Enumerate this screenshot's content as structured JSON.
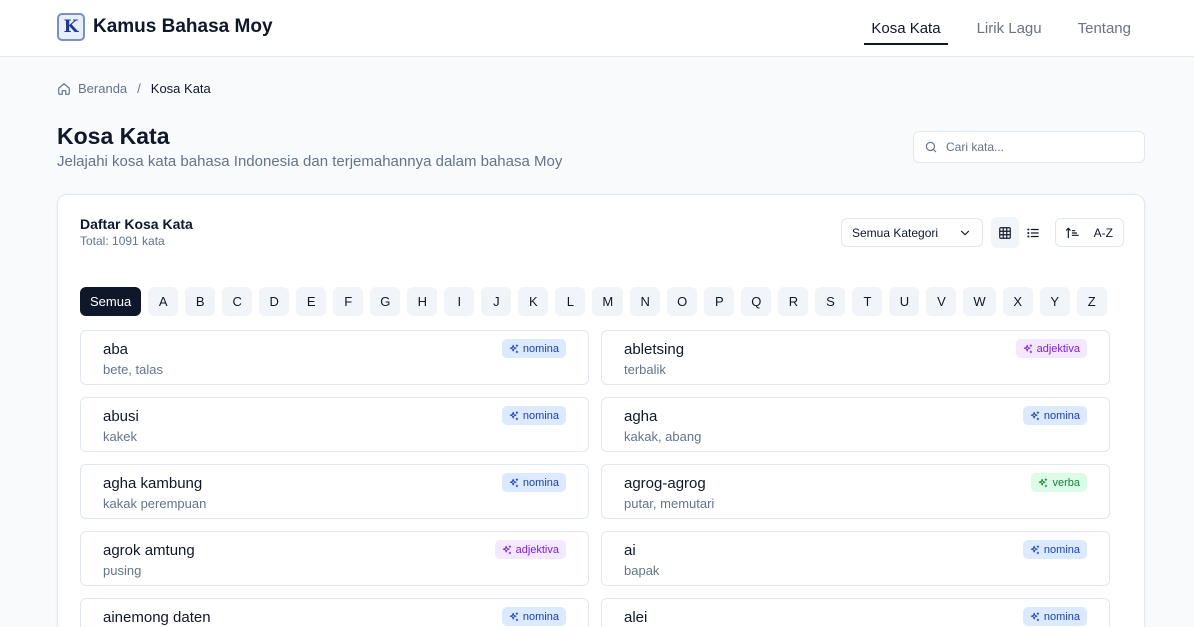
{
  "app": {
    "brand_logo_letter": "K",
    "brand_name": "Kamus Bahasa Moy"
  },
  "nav": {
    "items": [
      {
        "label": "Kosa Kata",
        "active": true
      },
      {
        "label": "Lirik Lagu",
        "active": false
      },
      {
        "label": "Tentang",
        "active": false
      }
    ]
  },
  "breadcrumb": {
    "home": "Beranda",
    "separator": "/",
    "current": "Kosa Kata"
  },
  "page": {
    "title": "Kosa Kata",
    "subtitle": "Jelajahi kosa kata bahasa Indonesia dan terjemahannya dalam bahasa Moy"
  },
  "search": {
    "placeholder": "Cari kata...",
    "value": ""
  },
  "card": {
    "title": "Daftar Kosa Kata",
    "count": "Total: 1091 kata",
    "category_select": "Semua Kategori",
    "sort_label": "A-Z",
    "view_mode": "grid"
  },
  "letters": [
    "Semua",
    "A",
    "B",
    "C",
    "D",
    "E",
    "F",
    "G",
    "H",
    "I",
    "J",
    "K",
    "L",
    "M",
    "N",
    "O",
    "P",
    "Q",
    "R",
    "S",
    "T",
    "U",
    "V",
    "W",
    "X",
    "Y",
    "Z"
  ],
  "active_letter": "Semua",
  "words": [
    {
      "term": "aba",
      "translation": "bete, talas",
      "category": "nomina"
    },
    {
      "term": "abletsing",
      "translation": "terbalik",
      "category": "adjektiva"
    },
    {
      "term": "abusi",
      "translation": "kakek",
      "category": "nomina"
    },
    {
      "term": "agha",
      "translation": "kakak, abang",
      "category": "nomina"
    },
    {
      "term": "agha kambung",
      "translation": "kakak perempuan",
      "category": "nomina"
    },
    {
      "term": "agrog-agrog",
      "translation": "putar, memutari",
      "category": "verba"
    },
    {
      "term": "agrok amtung",
      "translation": "pusing",
      "category": "adjektiva"
    },
    {
      "term": "ai",
      "translation": "bapak",
      "category": "nomina"
    },
    {
      "term": "ainemong daten",
      "translation": "",
      "category": "nomina"
    },
    {
      "term": "alei",
      "translation": "",
      "category": "nomina"
    }
  ],
  "colors": {
    "primary": "#0f172a",
    "muted": "#64748b",
    "nomina_bg": "#dbeafe",
    "adjektiva_bg": "#f3e8ff",
    "verba_bg": "#dcfce7"
  }
}
